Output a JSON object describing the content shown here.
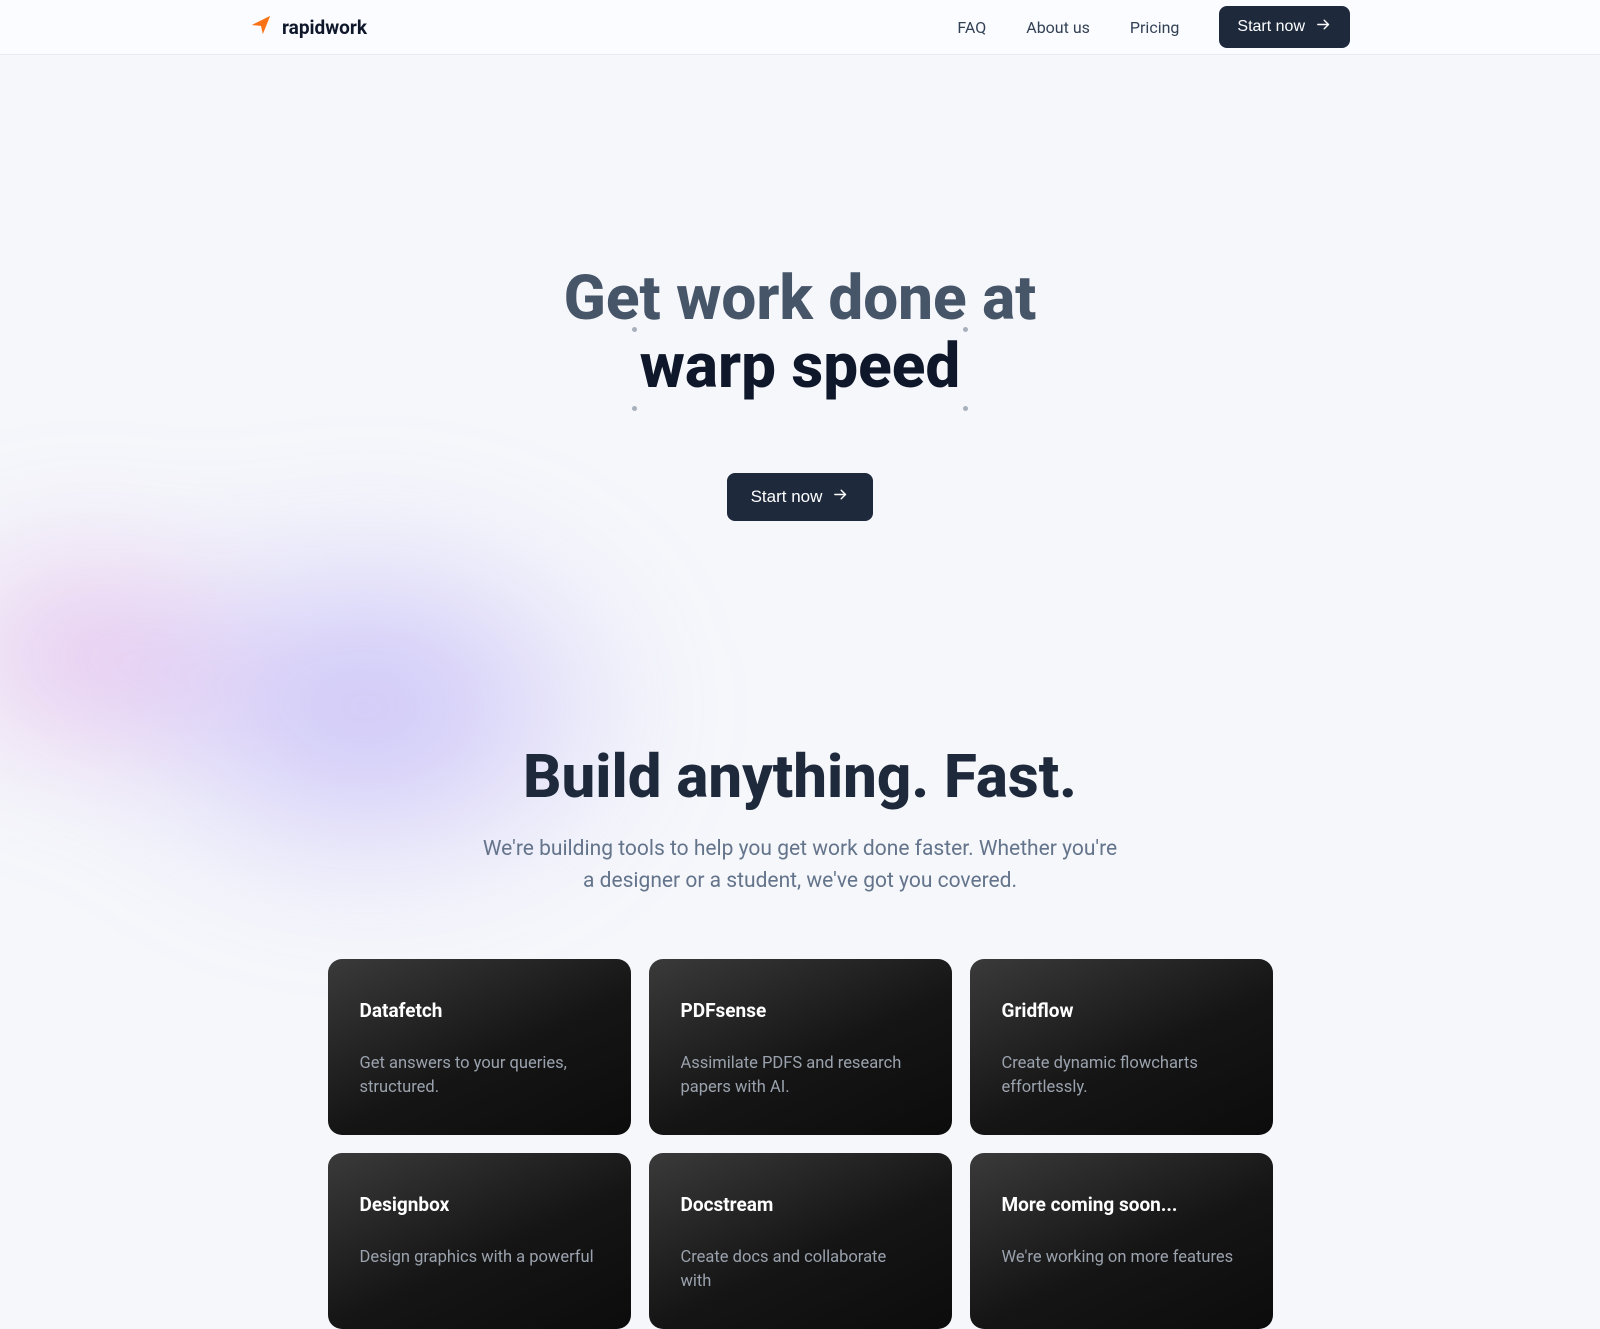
{
  "brand": {
    "name": "rapidwork"
  },
  "nav": {
    "links": [
      "FAQ",
      "About us",
      "Pricing"
    ],
    "cta": "Start now"
  },
  "hero": {
    "line1": "Get work done at",
    "line2": "warp speed",
    "cta": "Start now"
  },
  "section2": {
    "heading": "Build anything. Fast.",
    "sub": "We're building tools to help you get work done faster. Whether you're a designer or a student, we've got you covered."
  },
  "cards": [
    {
      "title": "Datafetch",
      "desc": "Get answers to your queries, structured."
    },
    {
      "title": "PDFsense",
      "desc": "Assimilate PDFS and research papers with AI."
    },
    {
      "title": "Gridflow",
      "desc": "Create dynamic flowcharts effortlessly."
    },
    {
      "title": "Designbox",
      "desc": "Design graphics with a powerful"
    },
    {
      "title": "Docstream",
      "desc": "Create docs and collaborate with"
    },
    {
      "title": "More coming soon...",
      "desc": "We're working on more features"
    }
  ]
}
